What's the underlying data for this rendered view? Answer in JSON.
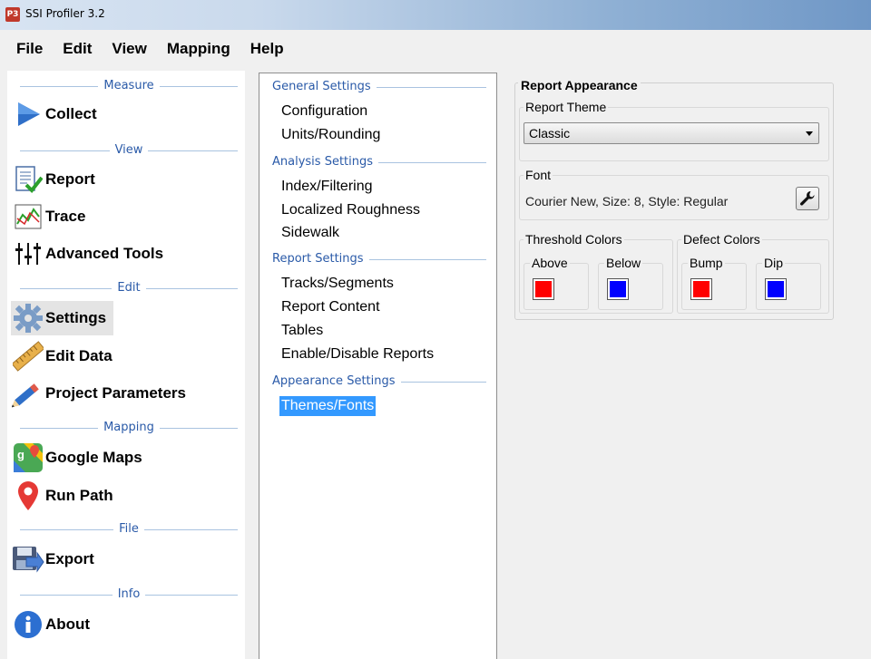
{
  "window": {
    "title": "SSI Profiler 3.2",
    "icon_text": "P3"
  },
  "menu": [
    "File",
    "Edit",
    "View",
    "Mapping",
    "Help"
  ],
  "nav": {
    "sections": {
      "measure": "Measure",
      "view": "View",
      "edit": "Edit",
      "mapping": "Mapping",
      "file": "File",
      "info": "Info"
    },
    "items": {
      "collect": "Collect",
      "report": "Report",
      "trace": "Trace",
      "advanced_tools": "Advanced Tools",
      "settings": "Settings",
      "edit_data": "Edit Data",
      "project_parameters": "Project Parameters",
      "google_maps": "Google Maps",
      "run_path": "Run Path",
      "export": "Export",
      "about": "About"
    }
  },
  "tree": {
    "general": {
      "label": "General Settings",
      "items": [
        "Configuration",
        "Units/Rounding"
      ]
    },
    "analysis": {
      "label": "Analysis Settings",
      "items": [
        "Index/Filtering",
        "Localized Roughness",
        "Sidewalk"
      ]
    },
    "report": {
      "label": "Report Settings",
      "items": [
        "Tracks/Segments",
        "Report Content",
        "Tables",
        "Enable/Disable Reports"
      ]
    },
    "appearance": {
      "label": "Appearance Settings",
      "items": [
        "Themes/Fonts"
      ]
    }
  },
  "panel": {
    "title": "Report Appearance",
    "theme_label": "Report Theme",
    "theme_value": "Classic",
    "font_label": "Font",
    "font_value": "Courier New, Size: 8, Style: Regular",
    "threshold_label": "Threshold Colors",
    "above_label": "Above",
    "below_label": "Below",
    "defect_label": "Defect Colors",
    "bump_label": "Bump",
    "dip_label": "Dip"
  },
  "colors": {
    "above": "#ff0000",
    "below": "#0000ff",
    "bump": "#ff0000",
    "dip": "#0000ff",
    "selection": "#3399ff",
    "section_text": "#2a5aa8"
  }
}
